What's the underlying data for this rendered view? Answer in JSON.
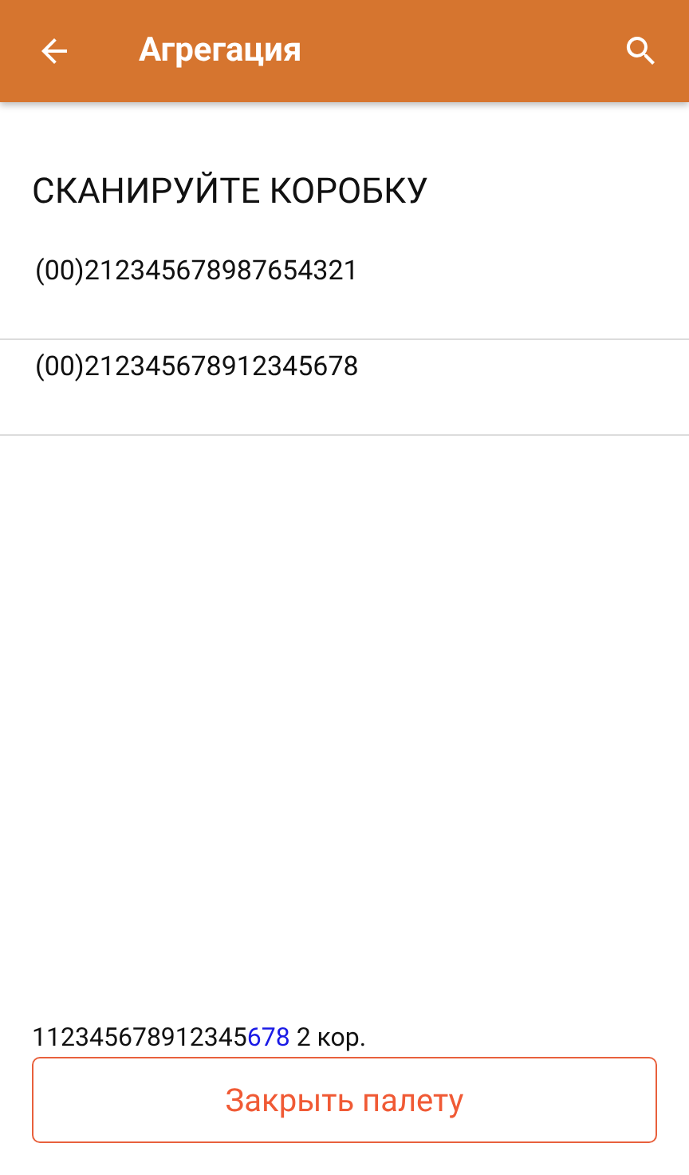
{
  "app_bar": {
    "title": "Агрегация"
  },
  "prompt": "СКАНИРУЙТЕ КОРОБКУ",
  "boxes": [
    {
      "code": "(00)212345678987654321"
    },
    {
      "code": "(00)212345678912345678"
    }
  ],
  "pallet": {
    "code_start": "112345678912345",
    "code_highlight": "678",
    "count": "2 кор."
  },
  "close_button": "Закрыть палету"
}
